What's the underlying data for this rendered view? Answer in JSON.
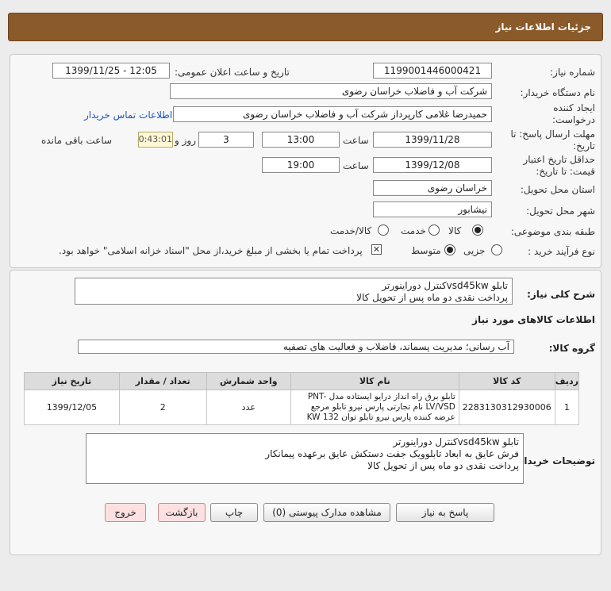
{
  "header": {
    "title": "جزئیات اطلاعات نیاز"
  },
  "info": {
    "need_number_label": "شماره نیاز:",
    "need_number": "1199001446000421",
    "announce_label": "تاریخ و ساعت اعلان عمومی:",
    "announce_value": "1399/11/25 - 12:05",
    "buyer_org_label": "نام دستگاه خریدار:",
    "buyer_org": "شرکت آب و فاضلاب خراسان رضوی",
    "creator_label": "ایجاد کننده درخواست:",
    "creator": "حمیدرضا غلامی کارپرداز شرکت آب و فاضلاب خراسان رضوی",
    "contact_link": "اطلاعات تماس خریدار",
    "reply_deadline_label": "مهلت ارسال پاسخ: تا تاریخ:",
    "reply_date": "1399/11/28",
    "time_label": "ساعت",
    "reply_time": "13:00",
    "days_value": "3",
    "days_label": "روز و",
    "remaining_time": "00:43:01",
    "remaining_label": "ساعت باقی مانده",
    "validity_label": "حداقل تاریخ اعتبار قیمت: تا تاریخ:",
    "validity_date": "1399/12/08",
    "validity_time": "19:00",
    "province_label": "استان محل تحویل:",
    "province": "خراسان رضوی",
    "city_label": "شهر محل تحویل:",
    "city": "نیشابور",
    "category_label": "طبقه بندی موضوعی:",
    "category_options": [
      "کالا",
      "خدمت",
      "کالا/خدمت"
    ],
    "process_label": "نوع فرآیند خرید :",
    "process_options": [
      "جزیی",
      "متوسط"
    ],
    "payment_note": "پرداخت تمام یا بخشی از مبلغ خرید،از محل \"اسناد خزانه اسلامی\" خواهد بود."
  },
  "summary": {
    "label": "شرح کلی نیاز:",
    "text": "تابلو vsd45kwکنترل دوراینورتر\nپرداخت نقدی دو ماه پس از تحویل کالا",
    "items_title": "اطلاعات کالاهای مورد نیاز",
    "group_label": "گروه کالا:",
    "group_value": "آب رسانی؛ مدیریت پسماند، فاضلاب و فعالیت های تصفیه"
  },
  "table": {
    "headers": [
      "ردیف",
      "کد کالا",
      "نام کالا",
      "واحد شمارش",
      "تعداد / مقدار",
      "تاریخ نیاز"
    ],
    "rows": [
      {
        "row": "1",
        "code": "2283130312930006",
        "name": "تابلو برق راه انداز درایو ایستاده مدل PNT-LV/VSD نام تجارتی پارس نیرو تابلو مرجع عرضه کننده پارس نیرو تابلو توان 132 KW",
        "unit": "عدد",
        "qty": "2",
        "date": "1399/12/05"
      }
    ]
  },
  "buyer_notes": {
    "label": "توضیحات خریدار:",
    "text": "تابلو vsd45kwکنترل دوراینورتر\nفرش عایق به ابعاد تابلوویک جفت دستکش عایق برعهده پیمانکار\nپرداخت نقدی دو ماه پس از تحویل کالا"
  },
  "buttons": {
    "reply": "پاسخ به نیاز",
    "attachments": "مشاهده مدارک پیوستی (0)",
    "print": "چاپ",
    "back": "بازگشت",
    "exit": "خروج"
  },
  "watermark": {
    "brand": "ParsNamadData"
  }
}
